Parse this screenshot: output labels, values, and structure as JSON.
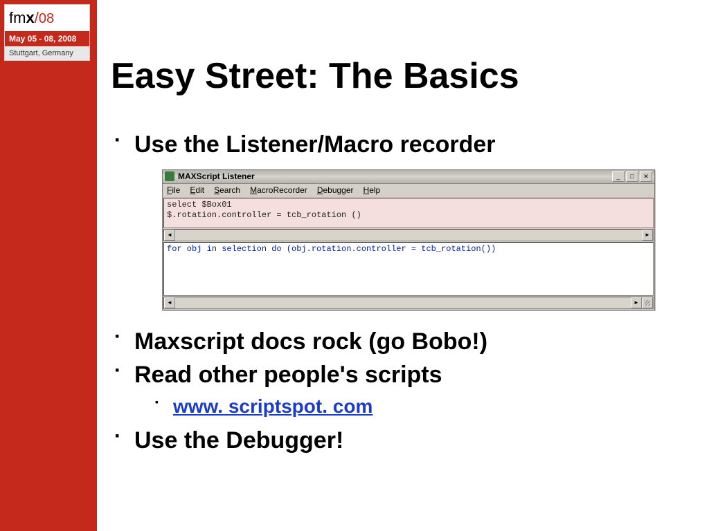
{
  "logo": {
    "brand_prefix": "fm",
    "brand_bold": "x",
    "slash": "/",
    "year": "08",
    "dates": "May 05 - 08, 2008",
    "location": "Stuttgart, Germany"
  },
  "slide": {
    "title": "Easy Street: The Basics",
    "bullets": {
      "b1": "Use the Listener/Macro recorder",
      "b2": "Maxscript docs rock (go Bobo!)",
      "b3": "Read other people's scripts",
      "b3_sub": "www. scriptspot. com",
      "b4": "Use the Debugger!"
    }
  },
  "window": {
    "title": "MAXScript Listener",
    "menu": {
      "file": "File",
      "edit": "Edit",
      "search": "Search",
      "macro": "MacroRecorder",
      "debugger": "Debugger",
      "help": "Help"
    },
    "pink_code_line1": "select $Box01",
    "pink_code_line2": "$.rotation.controller = tcb_rotation ()",
    "white_code_line1": "for obj in selection do (obj.rotation.controller = tcb_rotation())"
  }
}
